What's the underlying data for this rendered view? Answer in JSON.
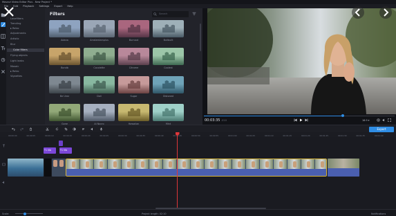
{
  "window": {
    "title": "Movavi Video Editor Plus - New Project *"
  },
  "menu": [
    {
      "label": "File"
    },
    {
      "label": "Edit"
    },
    {
      "label": "Playback"
    },
    {
      "label": "Settings"
    },
    {
      "label": "Export"
    },
    {
      "label": "Help"
    }
  ],
  "toolbar_icons": [
    "import-icon",
    "filters-icon",
    "transitions-icon",
    "titles-icon",
    "stickers-icon",
    "more-tools-icon"
  ],
  "categories": [
    {
      "label": "Lovefilters",
      "active": false
    },
    {
      "label": "Trending",
      "active": false
    },
    {
      "label": "▸ Retro",
      "active": false
    },
    {
      "label": "Adjustments",
      "active": false
    },
    {
      "label": "Artistic",
      "active": false
    },
    {
      "label": "Blur",
      "active": false
    },
    {
      "label": "Color filters",
      "active": true
    },
    {
      "label": "Flying objects",
      "active": false
    },
    {
      "label": "Light leaks",
      "active": false
    },
    {
      "label": "Mosaic",
      "active": false
    },
    {
      "label": "▸ Retro",
      "active": false
    },
    {
      "label": "Vignettes",
      "active": false
    }
  ],
  "filters_panel": {
    "title": "Filters",
    "search_placeholder": "Search",
    "items": [
      {
        "label": "Adana"
      },
      {
        "label": "Amsterdamplus"
      },
      {
        "label": "Burnout"
      },
      {
        "label": "Bullbuilt"
      },
      {
        "label": "Bondb"
      },
      {
        "label": "Cocolette"
      },
      {
        "label": "Citrome"
      },
      {
        "label": "Coolest"
      },
      {
        "label": "Be Urez"
      },
      {
        "label": "Dali"
      },
      {
        "label": "Sugar"
      },
      {
        "label": "Distoned"
      },
      {
        "label": "Gone"
      },
      {
        "label": "Al Nocro"
      },
      {
        "label": "Hawaiian"
      },
      {
        "label": "Mint"
      }
    ]
  },
  "preview": {
    "timecode": "00:03:35",
    "timecode_frames": ".010",
    "progress": 0.73,
    "aspect_ratio": "16:9 ▾"
  },
  "timeline": {
    "export_label": "Export",
    "ruler_ticks": [
      "00:00:00",
      "00:00:05",
      "00:00:10",
      "00:00:15",
      "00:00:20",
      "00:00:25",
      "00:00:30",
      "00:00:35",
      "00:00:40",
      "00:00:45",
      "00:00:50",
      "00:00:55",
      "00:01:00",
      "00:01:05",
      "00:01:10",
      "00:01:15",
      "00:01:20",
      "00:01:25",
      "00:01:30",
      "00:01:35",
      "00:01:40"
    ],
    "title_clip_1": "T1 Vlb",
    "title_clip_2": "T1 Vlb"
  },
  "status": {
    "scale_label": "Scale:",
    "project_length": "Project length: 02:10",
    "notifications": "Notifications"
  },
  "colors": {
    "accent": "#2f8de4",
    "playhead": "#e0373a",
    "active_category": "#33353f",
    "clip_border": "#d9b63a"
  }
}
